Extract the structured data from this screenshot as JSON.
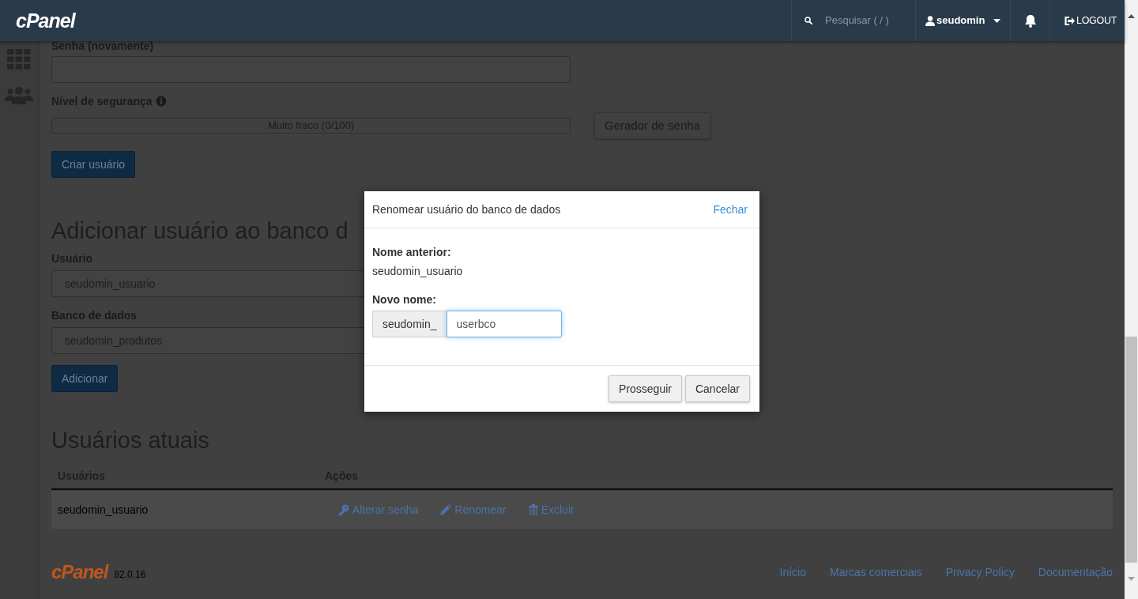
{
  "header": {
    "logo": "cPanel",
    "search": {
      "placeholder": "Pesquisar ( / )"
    },
    "user": "seudomin",
    "logout": "LOGOUT"
  },
  "create_user": {
    "password_again_label": "Senha (novamente)",
    "strength_label": "Nível de segurança",
    "strength_meter": {
      "text": "Muito fraco (0/100)",
      "level": 0
    },
    "generator_button": "Gerador de senha",
    "submit_button": "Criar usuário"
  },
  "add_user": {
    "heading": "Adicionar usuário ao banco d",
    "user_label": "Usuário",
    "user_value": "seudomin_usuario",
    "database_label": "Banco de dados",
    "database_value": "seudomin_produtos",
    "submit_button": "Adicionar"
  },
  "current_users": {
    "heading": "Usuários atuais",
    "columns": [
      "Usuários",
      "Ações"
    ],
    "rows": [
      {
        "user": "seudomin_usuario",
        "actions": [
          {
            "kind": "password",
            "label": "Alterar senha"
          },
          {
            "kind": "rename",
            "label": "Renomear"
          },
          {
            "kind": "delete",
            "label": "Excluir"
          }
        ]
      }
    ]
  },
  "footer": {
    "logo": "cPanel",
    "version": "82.0.16",
    "links": [
      "Início",
      "Marcas comerciais",
      "Privacy Policy",
      "Documentação"
    ]
  },
  "modal": {
    "title": "Renomear usuário do banco de dados",
    "close": "Fechar",
    "old_name_label": "Nome anterior:",
    "old_name": "seudomin_usuario",
    "new_name_label": "Novo nome:",
    "prefix": "seudomin_",
    "new_name_value": "userbco",
    "buttons": [
      "Prosseguir",
      "Cancelar"
    ]
  }
}
